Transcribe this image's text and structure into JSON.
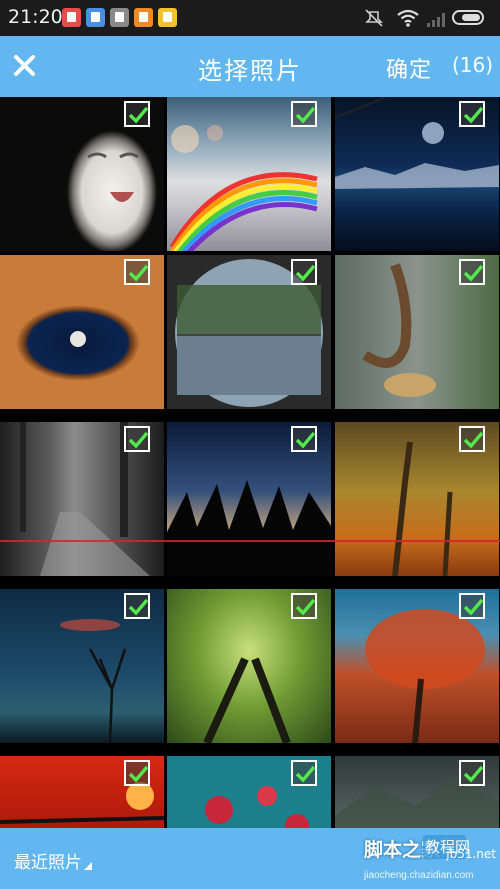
{
  "status_bar": {
    "time": "21:20",
    "app_icons": [
      {
        "name": "calendar-app-icon",
        "color": "#e94b4b"
      },
      {
        "name": "messenger-app-icon",
        "color": "#4a90e2"
      },
      {
        "name": "grey-app-icon",
        "color": "#8a8a8a"
      },
      {
        "name": "orange-app-icon",
        "color": "#f08a24"
      },
      {
        "name": "gallery-app-icon",
        "color": "#f2c228"
      }
    ]
  },
  "header": {
    "close_icon": "close-icon",
    "title": "选择照片",
    "confirm_label": "确定",
    "selected_count": "(16)"
  },
  "photos": [
    {
      "subject": "snowy owl",
      "checked": true
    },
    {
      "subject": "rainbow above clouds",
      "checked": true
    },
    {
      "subject": "moon over lake at night",
      "checked": true
    },
    {
      "subject": "moon through rock arch",
      "checked": true
    },
    {
      "subject": "round reflection of trees",
      "checked": true
    },
    {
      "subject": "birds falling",
      "checked": true
    },
    {
      "subject": "misty forest road",
      "checked": true
    },
    {
      "subject": "tree silhouettes at dusk",
      "checked": true
    },
    {
      "subject": "autumn forest",
      "checked": true
    },
    {
      "subject": "bare tree at dusk",
      "checked": true
    },
    {
      "subject": "looking up at green trees",
      "checked": true
    },
    {
      "subject": "red autumn tree",
      "checked": true
    },
    {
      "subject": "red sunset",
      "checked": true
    },
    {
      "subject": "red flowers on teal",
      "checked": true
    },
    {
      "subject": "misty mountains",
      "checked": true
    }
  ],
  "footer": {
    "album_label": "最近照片",
    "watermark_line1": "脚本之家",
    "watermark_badge": "教程网",
    "watermark_url": "jb51.net",
    "watermark_url2": "jiaocheng.chazidian.com"
  }
}
